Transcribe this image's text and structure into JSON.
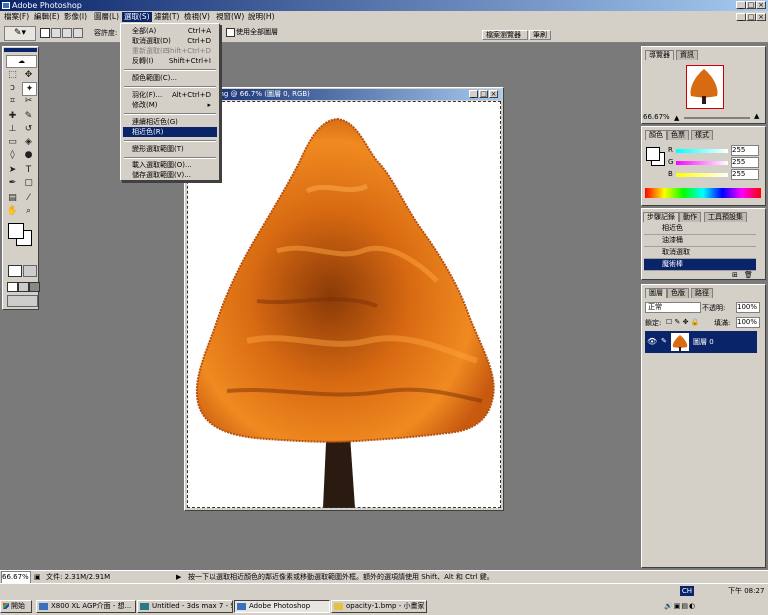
{
  "window": {
    "title": "Adobe Photoshop"
  },
  "menubar": {
    "items": [
      "檔案(F)",
      "編輯(E)",
      "影像(I)",
      "圖層(L)",
      "選取(S)",
      "濾鏡(T)",
      "檢視(V)",
      "視窗(W)",
      "說明(H)"
    ]
  },
  "options": {
    "tolerance_label": "容許度:",
    "all_layers_label": "使用全部圖層"
  },
  "panel_well": {
    "tabs": [
      "檔案瀏覽器",
      "筆刷"
    ]
  },
  "select_menu": {
    "items": [
      {
        "label": "全部(A)",
        "shortcut": "Ctrl+A",
        "disabled": false
      },
      {
        "label": "取消選取(D)",
        "shortcut": "Ctrl+D",
        "disabled": false
      },
      {
        "label": "重新選取(E)",
        "shortcut": "Shift+Ctrl+D",
        "disabled": true
      },
      {
        "label": "反轉(I)",
        "shortcut": "Shift+Ctrl+I",
        "disabled": false
      },
      {
        "label": "顏色範圍(C)...",
        "shortcut": "",
        "disabled": false
      },
      {
        "label": "羽化(F)...",
        "shortcut": "Alt+Ctrl+D",
        "disabled": false
      },
      {
        "label": "修改(M)",
        "shortcut": "▸",
        "disabled": false
      },
      {
        "label": "連續相近色(G)",
        "shortcut": "",
        "disabled": false
      },
      {
        "label": "相近色(R)",
        "shortcut": "",
        "disabled": false
      },
      {
        "label": "變形選取範圍(T)",
        "shortcut": "",
        "disabled": false
      },
      {
        "label": "載入選取範圍(O)...",
        "shortcut": "",
        "disabled": false
      },
      {
        "label": "儲存選取範圍(V)...",
        "shortcut": "",
        "disabled": false
      }
    ],
    "highlighted_index": 8
  },
  "document": {
    "title": "0.170).png @ 66.7% (圖層 0, RGB)"
  },
  "navigator": {
    "tabs": [
      "導覽器",
      "資訊"
    ],
    "zoom": "66.67%"
  },
  "color_panel": {
    "tabs": [
      "顏色",
      "色票",
      "樣式"
    ],
    "channels": [
      {
        "label": "R",
        "value": "255",
        "color": "#e02020"
      },
      {
        "label": "G",
        "value": "255",
        "color": "#20b020"
      },
      {
        "label": "B",
        "value": "255",
        "color": "#2020e0"
      }
    ]
  },
  "history_panel": {
    "tabs": [
      "步驟記錄",
      "動作",
      "工具預設集"
    ],
    "items": [
      "相近色",
      "油漆桶",
      "取消選取",
      "魔術棒"
    ],
    "selected_index": 3
  },
  "layers_panel": {
    "tabs": [
      "圖層",
      "色版",
      "路徑"
    ],
    "blend_mode": "正常",
    "opacity_label": "不透明:",
    "opacity": "100%",
    "lock_label": "鎖定:",
    "fill_label": "填滿:",
    "fill": "100%",
    "layers": [
      {
        "name": "圖層 0",
        "selected": true
      }
    ]
  },
  "status": {
    "zoom": "66.67%",
    "doc_info": "文件: 2.31M/2.91M",
    "hint": "按一下以選取相近顏色的鄰近像素或移動選取範圍外框。額外的選項請使用 Shift、Alt 和 Ctrl 鍵。"
  },
  "taskbar": {
    "start_label": "開始",
    "buttons": [
      "X800 XL AGP介面 - 想...",
      "Untitled - 3ds max 7 - Stu...",
      "Adobe Photoshop",
      "opacity-1.bmp - 小畫家"
    ],
    "active_index": 2,
    "clock": "下午 08:27",
    "ime": "CH"
  },
  "colors": {
    "accent": "#0a246a",
    "chrome": "#d4d0c8",
    "workspace": "#7a7a7a",
    "foliage": "#e07a1a",
    "trunk": "#2a1a10"
  }
}
